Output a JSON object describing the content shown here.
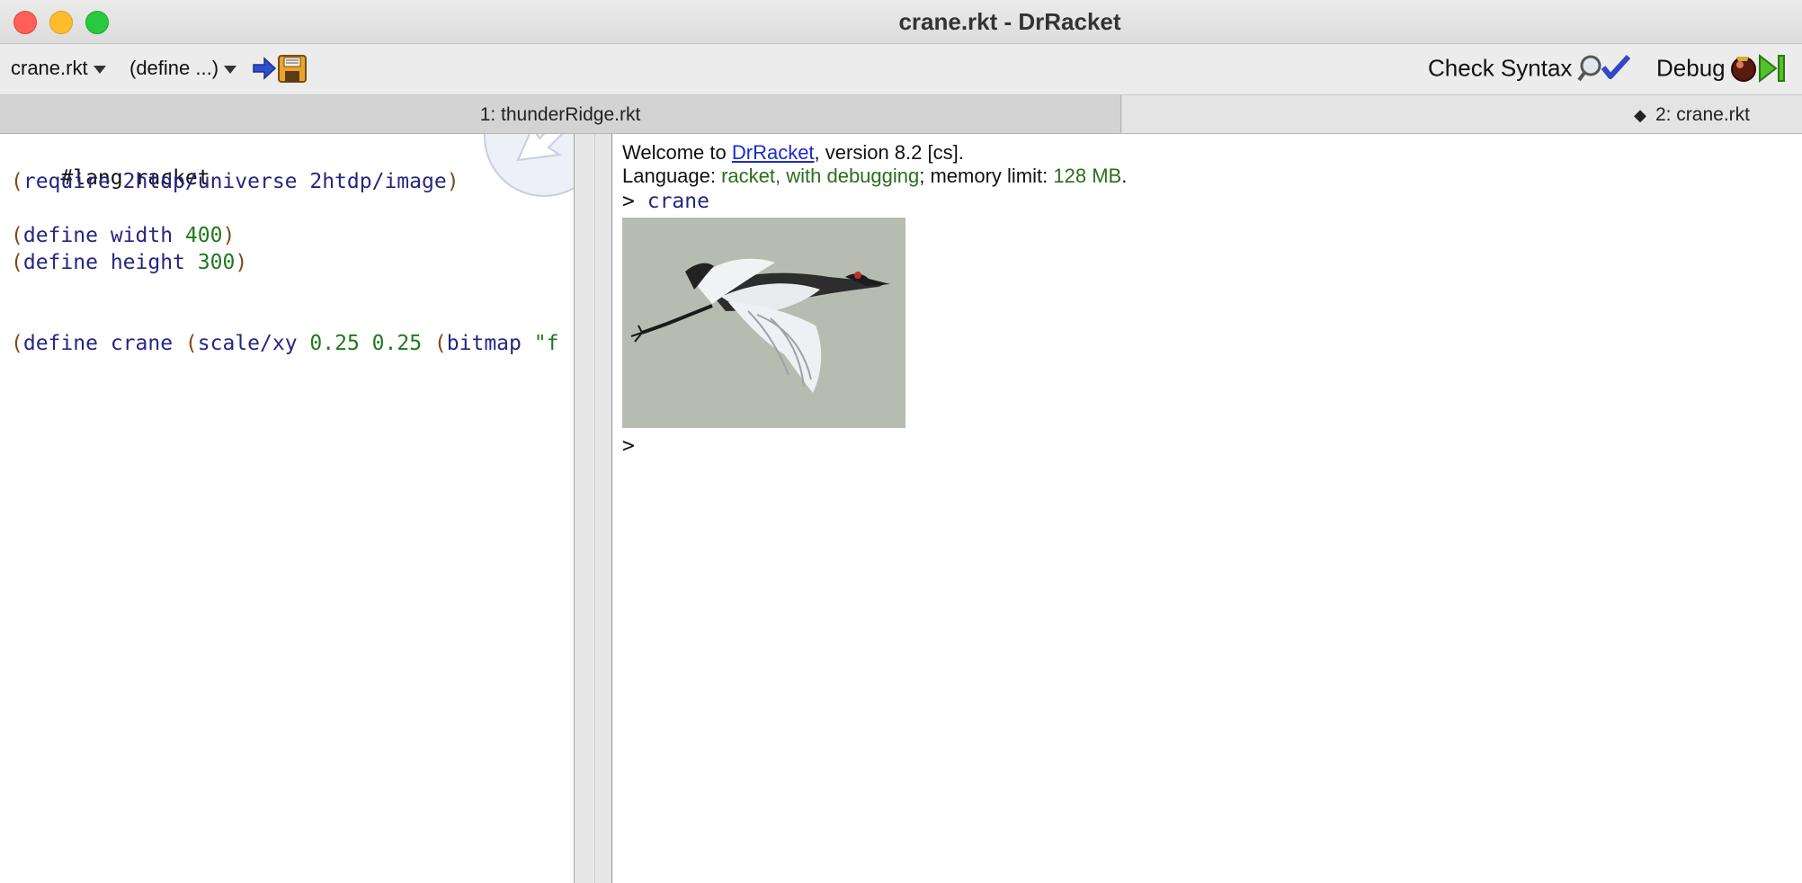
{
  "window": {
    "title": "crane.rkt - DrRacket"
  },
  "toolbar": {
    "file_menu": "crane.rkt",
    "define_menu": "(define ...)",
    "check_syntax_label": "Check Syntax",
    "debug_label": "Debug"
  },
  "tabs": [
    {
      "label": "1: thunderRidge.rkt"
    },
    {
      "label": "2: crane.rkt",
      "marker": "◆"
    }
  ],
  "editor": {
    "lang": "#lang racket",
    "require": {
      "kw": "require",
      "args": "2htdp/universe 2htdp/image"
    },
    "width_def": {
      "kw": "define",
      "name": "width",
      "value": "400"
    },
    "height_def": {
      "kw": "define",
      "name": "height",
      "value": "300"
    },
    "crane_def": {
      "kw": "define",
      "name": "crane",
      "fn": "scale/xy",
      "a": "0.25",
      "b": "0.25",
      "inner": "bitmap",
      "str": "\"f"
    }
  },
  "interactions": {
    "welcome_prefix": "Welcome to ",
    "welcome_link": "DrRacket",
    "welcome_suffix": ", version 8.2 [cs].",
    "language_prefix": "Language: ",
    "language_value": "racket, with debugging",
    "memory_prefix": "; memory limit: ",
    "memory_value": "128 MB",
    "memory_suffix": ".",
    "prompt": ">",
    "input": "crane",
    "prompt2": ">"
  },
  "colors": {
    "keyword": "#262680",
    "paren": "#84461e",
    "literal": "#1e7a1e",
    "link": "#1a2cc8",
    "image_bg": "#b6bcaf"
  }
}
